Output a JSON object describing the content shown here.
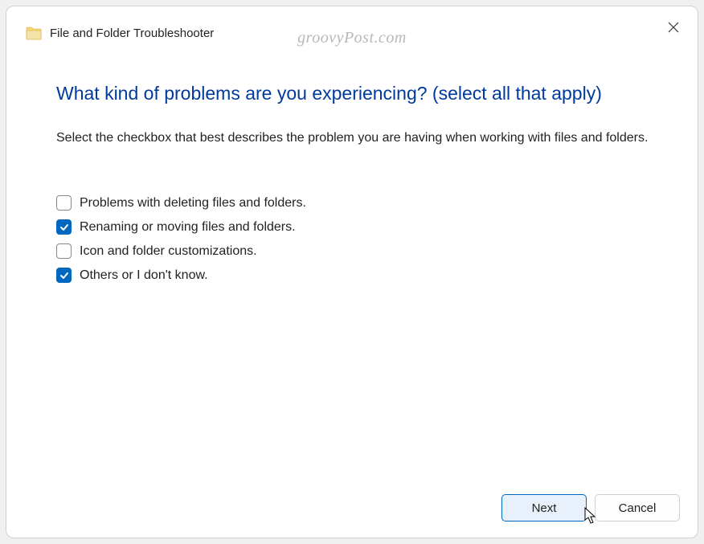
{
  "watermark": "groovyPost.com",
  "header": {
    "title": "File and Folder Troubleshooter"
  },
  "main": {
    "question": "What kind of problems are you experiencing? (select all that apply)",
    "instructions": "Select the checkbox that best describes the problem you are having when working with files and folders.",
    "options": [
      {
        "label": "Problems with deleting files and folders.",
        "checked": false
      },
      {
        "label": "Renaming or moving files and folders.",
        "checked": true
      },
      {
        "label": "Icon and folder customizations.",
        "checked": false
      },
      {
        "label": "Others or I don't know.",
        "checked": true
      }
    ]
  },
  "footer": {
    "next_label": "Next",
    "cancel_label": "Cancel"
  }
}
